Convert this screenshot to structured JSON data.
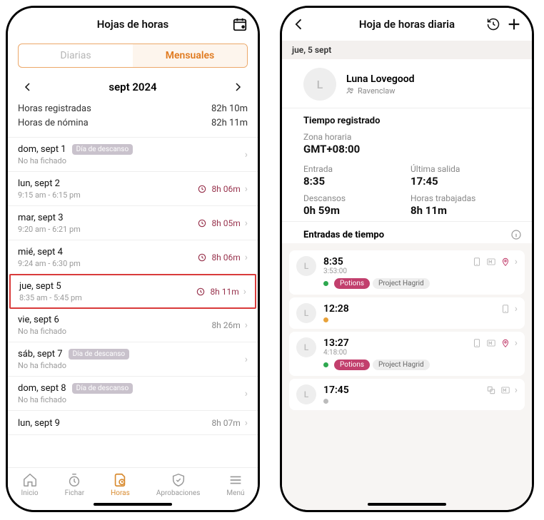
{
  "left": {
    "title": "Hojas de horas",
    "seg_daily": "Diarias",
    "seg_monthly": "Mensuales",
    "month_label": "sept 2024",
    "summary_logged_label": "Horas registradas",
    "summary_logged_value": "82h 10m",
    "summary_payroll_label": "Horas de nómina",
    "summary_payroll_value": "82h 11m",
    "days": [
      {
        "title": "dom, sept 1",
        "sub": "No ha fichado",
        "badge": "Día de descanso",
        "hours": ""
      },
      {
        "title": "lun, sept 2",
        "sub": "9:15 am - 6:15 pm",
        "hours": "8h 06m",
        "color": "maroon"
      },
      {
        "title": "mar, sept 3",
        "sub": "9:20 am - 6:21 pm",
        "hours": "8h 05m",
        "color": "maroon"
      },
      {
        "title": "mié, sept 4",
        "sub": "9:24 am - 6:30 pm",
        "hours": "8h 06m",
        "color": "maroon"
      },
      {
        "title": "jue, sept 5",
        "sub": "8:35 am - 5:45 pm",
        "hours": "8h 11m",
        "color": "maroon",
        "highlight": true
      },
      {
        "title": "vie, sept 6",
        "sub": "No ha fichado",
        "hours": "8h 26m",
        "color": "grey"
      },
      {
        "title": "sáb, sept 7",
        "sub": "No ha fichado",
        "badge": "Día de descanso",
        "hours": ""
      },
      {
        "title": "dom, sept 8",
        "sub": "No ha fichado",
        "badge": "Día de descanso",
        "hours": ""
      },
      {
        "title": "lun, sept 9",
        "sub": "",
        "hours": "8h 07m",
        "color": "grey"
      }
    ],
    "tabs": {
      "home": "Inicio",
      "clock": "Fichar",
      "hours": "Horas",
      "approvals": "Aprobaciones",
      "menu": "Menú"
    }
  },
  "right": {
    "title": "Hoja de horas diaria",
    "date_bar": "jue, 5 sept",
    "user_name": "Luna Lovegood",
    "user_initial": "L",
    "user_team": "Ravenclaw",
    "section_time": "Tiempo registrado",
    "tz_label": "Zona horaria",
    "tz_value": "GMT+08:00",
    "in_label": "Entrada",
    "in_value": "8:35",
    "out_label": "Última salida",
    "out_value": "17:45",
    "breaks_label": "Descansos",
    "breaks_value": "0h 59m",
    "worked_label": "Horas trabajadas",
    "worked_value": "8h 11m",
    "entries_title": "Entradas de tiempo",
    "entries": [
      {
        "time": "8:35",
        "dur": "3:53:00",
        "dot": "green",
        "tags": [
          "Potions",
          "Project Hagrid"
        ],
        "icons": [
          "cup",
          "m",
          "pin"
        ]
      },
      {
        "time": "12:28",
        "dot": "orange",
        "icons": [
          "cup"
        ]
      },
      {
        "time": "13:27",
        "dur": "4:18:00",
        "dot": "green",
        "tags": [
          "Potions",
          "Project Hagrid"
        ],
        "icons": [
          "cup",
          "m",
          "pin"
        ]
      },
      {
        "time": "17:45",
        "dot": "grey",
        "icons": [
          "overlap",
          "m"
        ]
      }
    ]
  }
}
